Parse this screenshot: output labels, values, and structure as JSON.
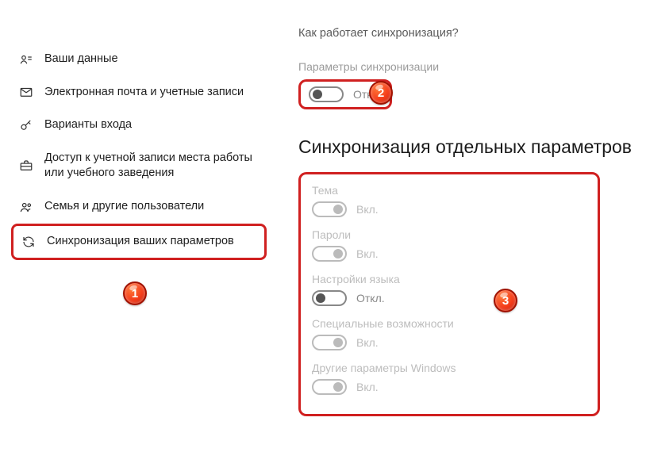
{
  "sidebar": {
    "items": [
      {
        "label": "Ваши данные"
      },
      {
        "label": "Электронная почта и учетные записи"
      },
      {
        "label": "Варианты входа"
      },
      {
        "label": "Доступ к учетной записи места работы или учебного заведения"
      },
      {
        "label": "Семья и другие пользователи"
      },
      {
        "label": "Синхронизация ваших параметров"
      }
    ]
  },
  "content": {
    "question_link": "Как работает синхронизация?",
    "master_label": "Параметры синхронизации",
    "master_state": "Откл.",
    "heading": "Синхронизация отдельных параметров",
    "settings": [
      {
        "label": "Тема",
        "state": "Вкл.",
        "on": true,
        "disabled": true
      },
      {
        "label": "Пароли",
        "state": "Вкл.",
        "on": true,
        "disabled": true
      },
      {
        "label": "Настройки языка",
        "state": "Откл.",
        "on": false,
        "disabled": false
      },
      {
        "label": "Специальные возможности",
        "state": "Вкл.",
        "on": true,
        "disabled": true
      },
      {
        "label": "Другие параметры Windows",
        "state": "Вкл.",
        "on": true,
        "disabled": true
      }
    ]
  },
  "annotations": {
    "badge1": "1",
    "badge2": "2",
    "badge3": "3"
  }
}
